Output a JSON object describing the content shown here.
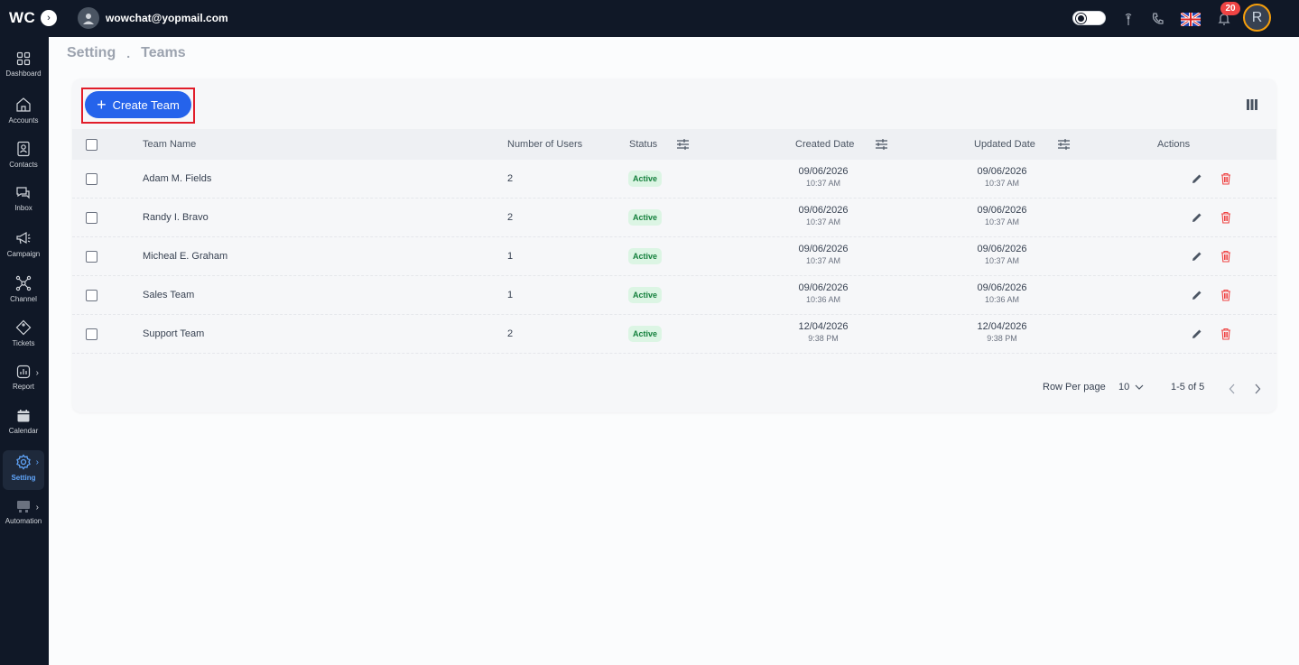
{
  "app": {
    "logo_text": "WC",
    "user_email": "wowchat@yopmail.com",
    "notification_count": "20",
    "profile_initial": "R"
  },
  "sidebar": {
    "items": [
      {
        "label": "Dashboard"
      },
      {
        "label": "Accounts"
      },
      {
        "label": "Contacts"
      },
      {
        "label": "Inbox"
      },
      {
        "label": "Campaign"
      },
      {
        "label": "Channel"
      },
      {
        "label": "Tickets"
      },
      {
        "label": "Report"
      },
      {
        "label": "Calendar"
      },
      {
        "label": "Setting"
      },
      {
        "label": "Automation"
      }
    ]
  },
  "breadcrumb": {
    "parent": "Setting",
    "separator": ".",
    "current": "Teams"
  },
  "toolbar": {
    "create_label": "Create Team"
  },
  "table": {
    "headers": {
      "team_name": "Team Name",
      "users": "Number of Users",
      "status": "Status",
      "created": "Created Date",
      "updated": "Updated Date",
      "actions": "Actions"
    },
    "rows": [
      {
        "name": "Adam M. Fields",
        "users": "2",
        "status": "Active",
        "created_date": "09/06/2026",
        "created_time": "10:37 AM",
        "updated_date": "09/06/2026",
        "updated_time": "10:37 AM"
      },
      {
        "name": "Randy I. Bravo",
        "users": "2",
        "status": "Active",
        "created_date": "09/06/2026",
        "created_time": "10:37 AM",
        "updated_date": "09/06/2026",
        "updated_time": "10:37 AM"
      },
      {
        "name": "Micheal E. Graham",
        "users": "1",
        "status": "Active",
        "created_date": "09/06/2026",
        "created_time": "10:37 AM",
        "updated_date": "09/06/2026",
        "updated_time": "10:37 AM"
      },
      {
        "name": "Sales Team",
        "users": "1",
        "status": "Active",
        "created_date": "09/06/2026",
        "created_time": "10:36 AM",
        "updated_date": "09/06/2026",
        "updated_time": "10:36 AM"
      },
      {
        "name": "Support Team",
        "users": "2",
        "status": "Active",
        "created_date": "12/04/2026",
        "created_time": "9:38 PM",
        "updated_date": "12/04/2026",
        "updated_time": "9:38 PM"
      }
    ]
  },
  "pagination": {
    "rows_label": "Row Per page",
    "rows_value": "10",
    "range": "1-5 of 5"
  },
  "colors": {
    "accent": "#2563eb",
    "topbar": "#101827",
    "status_bg": "#dcf5e4",
    "status_text": "#15803d",
    "delete": "#ef4444"
  }
}
